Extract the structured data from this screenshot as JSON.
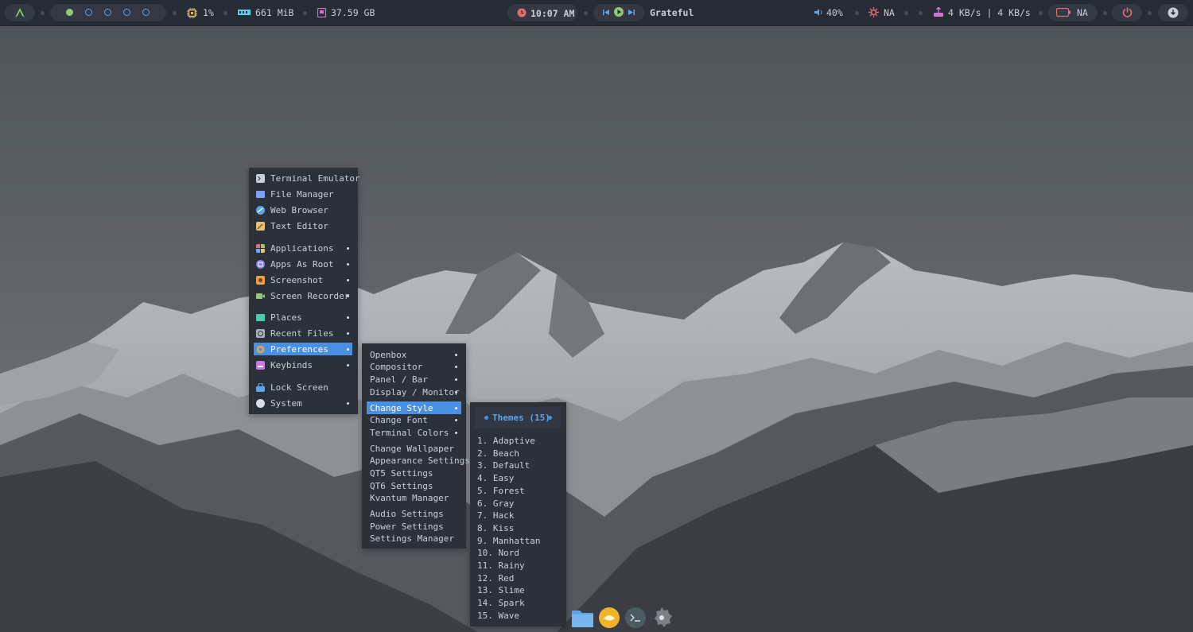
{
  "topbar": {
    "cpu": "1%",
    "ram": "661 MiB",
    "disk": "37.59 GB",
    "clock": "10:07 AM",
    "song": "Grateful",
    "volume": "40%",
    "brightness": "NA",
    "network": "4 KB/s | 4 KB/s",
    "battery": "NA",
    "workspaces": [
      "active",
      "empty",
      "empty",
      "empty",
      "empty"
    ]
  },
  "main_menu": {
    "group1": [
      "Terminal Emulator",
      "File Manager",
      "Web Browser",
      "Text Editor"
    ],
    "group2": [
      "Applications",
      "Apps As Root",
      "Screenshot",
      "Screen Recorder"
    ],
    "group3": [
      "Places",
      "Recent Files",
      "Preferences",
      "Keybinds"
    ],
    "group4": [
      "Lock Screen",
      "System"
    ],
    "selected": "Preferences"
  },
  "pref_menu": {
    "group1": [
      "Openbox",
      "Compositor",
      "Panel / Bar",
      "Display / Monitor"
    ],
    "group2": [
      "Change Style",
      "Change Font",
      "Terminal Colors"
    ],
    "group3": [
      "Change Wallpaper",
      "Appearance Settings",
      "QT5 Settings",
      "QT6 Settings",
      "Kvantum Manager"
    ],
    "group4": [
      "Audio Settings",
      "Power Settings",
      "Settings Manager"
    ],
    "selected": "Change Style"
  },
  "themes_menu": {
    "header": "Themes (15)",
    "items": [
      "1. Adaptive",
      "2. Beach",
      "3. Default",
      "4. Easy",
      "5. Forest",
      "6. Gray",
      "7. Hack",
      "8. Kiss",
      "9. Manhattan",
      "10. Nord",
      "11. Rainy",
      "12. Red",
      "13. Slime",
      "14. Spark",
      "15. Wave"
    ]
  },
  "colors": {
    "accent": "#4a90e2",
    "menu_bg": "#2b3039",
    "bar_bg": "#272b33"
  }
}
